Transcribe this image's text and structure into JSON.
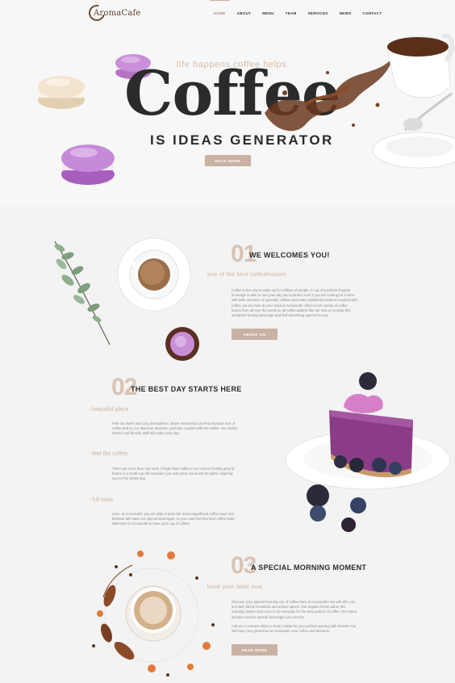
{
  "header": {
    "logo": "AromaCafe",
    "nav": [
      "HOME",
      "ABOUT",
      "MENU",
      "TEAM",
      "SERVICES",
      "NEWS",
      "CONTACT"
    ]
  },
  "hero": {
    "tagline": "life happens coffee helps",
    "title": "Coffee",
    "subtitle": "IS IDEAS GENERATOR",
    "button": "READ MORE"
  },
  "section1": {
    "number": "01",
    "title": "WE WELCOMES YOU!",
    "subtitle": "one of the best coffeehouses",
    "text": "Coffee is the way to wake up for millions of people. A cup of excellent fragrant beverage is able to turn your day into a perfect one! If you are looking for a store with wide selection of specialty coffees and many additional products coupled with coffee, we are here at your service! Aromacafe offers a rich variety of coffee beans from all over the world for all coffee-addicts like us! Visit us to taste this wonderful healing beverage and find something special for you!",
    "button": "ABOUT US"
  },
  "section2": {
    "number": "02",
    "title": "THE BEST DAY STARTS HERE",
    "features": [
      {
        "label": "- beautiful place",
        "text": "Feel our warm and cozy atmosphere, where everybody can find aromatic sort of coffee and try our delicious desserts, perfectly coupled with hot coffee. Our stylish interior and friendly staff will make your day!"
      },
      {
        "label": "- feel the coffee",
        "text": "There are more than 100 sorts of high-class coffee in our menu! Freshly ground beans in a small cup will empower you with great mood and thoughts, inspiring you for the whole day."
      },
      {
        "label": "- full taste",
        "text": "Here, at Aromacafe, you are able to taste the most magnificent coffee ever! Our baristas will make our special beverages, so you could feel the best coffee taste. Welcome to Aromacafe to have your cup of coffee!"
      }
    ]
  },
  "section3": {
    "number": "03",
    "title": "A SPECIAL MORNING MOMENT",
    "subtitle": "book your table now",
    "text1": "Discover your special morning cup of coffee here at Aromacafe! We will offer you aromatic blend of arabica and ariseni spices. Our regular clients adore this morning routine and come to us everyday for the best portion of coffee. Our menu includes various special beverages you can try!",
    "text2": "Call us or contact online to book a table for your perfect meeting with friends! You will have your great time at Aromacafe over coffee and desserts.",
    "button": "READ MORE"
  },
  "colors": {
    "accent": "#c9b2a3",
    "number": "#d8c3b4",
    "macaron_purple": "#c48ad8",
    "macaron_pink": "#b86fc9",
    "macaron_cream": "#f1e2cc"
  }
}
